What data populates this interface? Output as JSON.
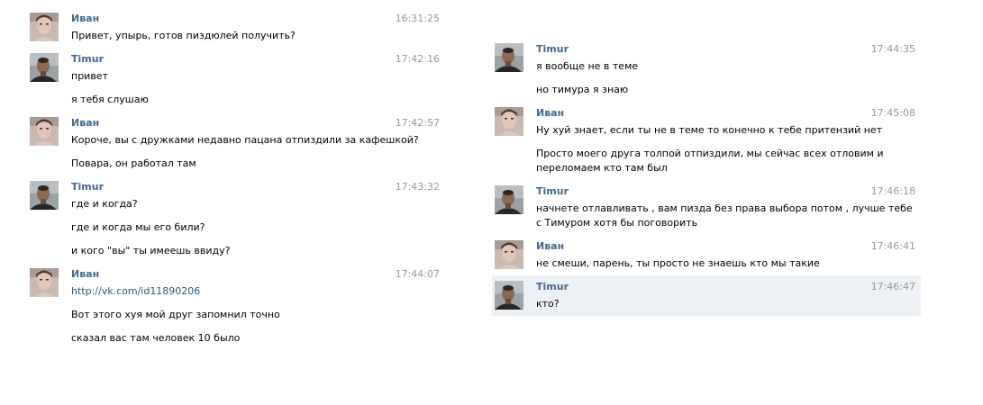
{
  "left_column": [
    {
      "author": "Иван",
      "avatar": "ivan",
      "time": "16:31:25",
      "lines": [
        "Привет, упырь, готов пиздюлей получить?"
      ]
    },
    {
      "author": "Timur",
      "avatar": "timur",
      "time": "17:42:16",
      "lines": [
        "привет",
        "я тебя слушаю"
      ]
    },
    {
      "author": "Иван",
      "avatar": "ivan",
      "time": "17:42:57",
      "lines": [
        "Короче, вы с дружками недавно пацана отпиздили за кафешкой?",
        "Повара, он работал там"
      ]
    },
    {
      "author": "Timur",
      "avatar": "timur",
      "time": "17:43:32",
      "lines": [
        "где и когда?",
        "где и когда мы его били?",
        "и кого \"вы\" ты имеешь ввиду?"
      ]
    },
    {
      "author": "Иван",
      "avatar": "ivan",
      "time": "17:44:07",
      "link": "http://vk.com/id11890206",
      "lines": [
        "Вот этого хуя мой друг запомнил точно",
        "сказал вас там человек 10 было"
      ]
    }
  ],
  "right_column": [
    {
      "author": "Timur",
      "avatar": "timur",
      "time": "17:44:35",
      "lines": [
        "я вообще не в теме",
        "но тимура я знаю"
      ]
    },
    {
      "author": "Иван",
      "avatar": "ivan",
      "time": "17:45:08",
      "lines": [
        "Ну хуй знает, если ты не в теме то конечно к тебе притензий нет",
        "Просто моего друга толпой отпиздили, мы сейчас всех отловим и переломаем кто там был"
      ]
    },
    {
      "author": "Timur",
      "avatar": "timur",
      "time": "17:46:18",
      "lines": [
        "начнете отлавливать , вам пизда без права выбора потом , лучше тебе с Тимуром хотя бы поговорить"
      ]
    },
    {
      "author": "Иван",
      "avatar": "ivan",
      "time": "17:46:41",
      "lines": [
        "не смеши, парень, ты просто не знаешь кто мы такие"
      ]
    },
    {
      "author": "Timur",
      "avatar": "timur",
      "time": "17:46:47",
      "highlight": true,
      "lines": [
        "кто?"
      ]
    }
  ],
  "colors": {
    "author": "#45688e",
    "time": "#999999",
    "link": "#2b587a",
    "highlight_bg": "#edf1f5"
  }
}
